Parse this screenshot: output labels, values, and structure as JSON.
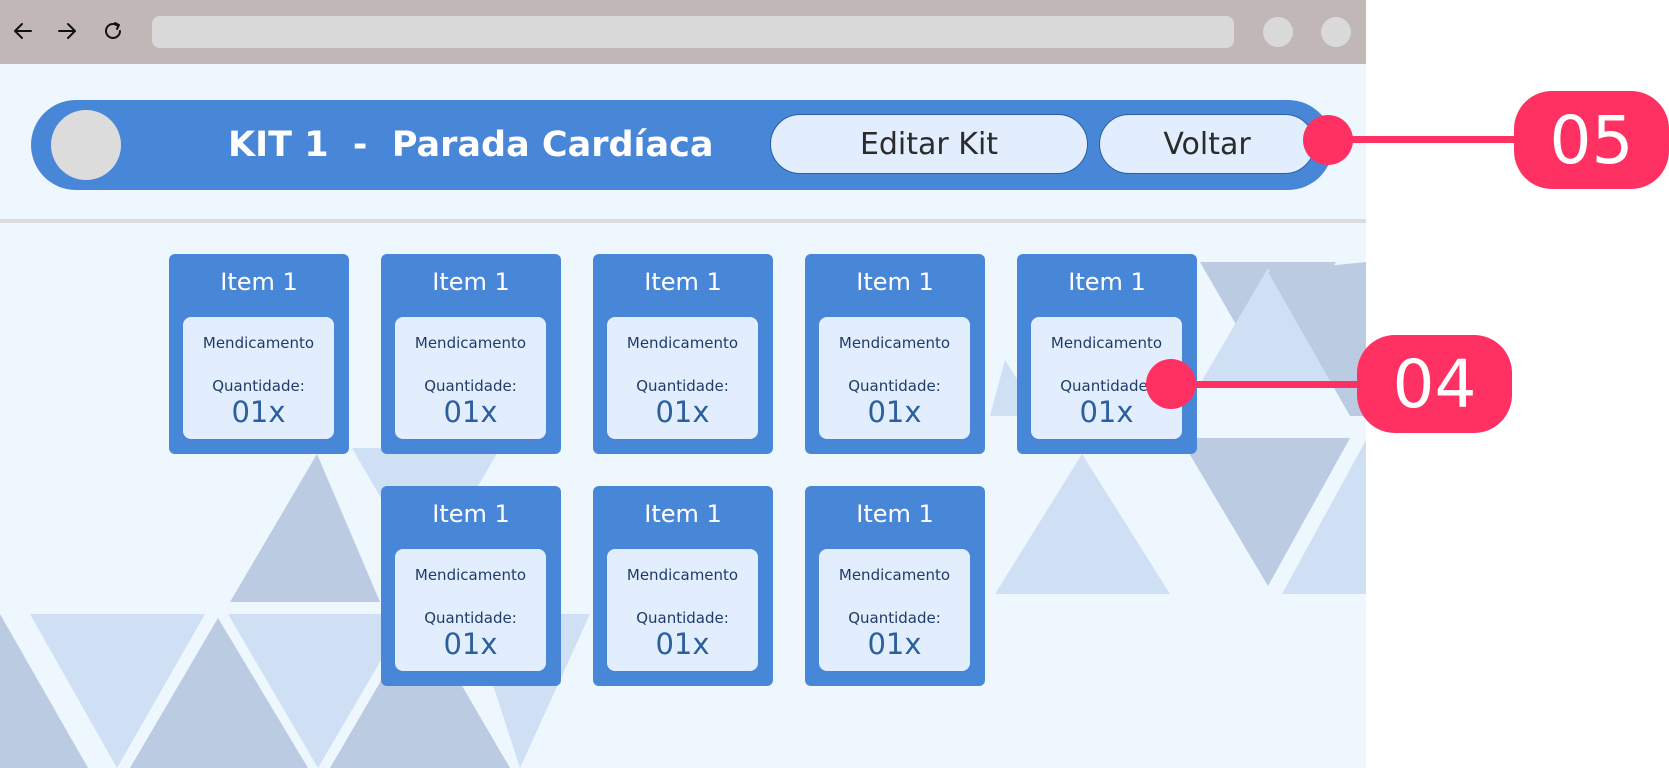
{
  "browser": {
    "icons": [
      "arrow-left-icon",
      "arrow-right-icon",
      "refresh-icon"
    ]
  },
  "header": {
    "title": "KIT 1  -  Parada Cardíaca",
    "edit_label": "Editar Kit",
    "back_label": "Voltar"
  },
  "items": [
    {
      "title": "Item 1",
      "med": "Mendicamento",
      "qty_label": "Quantidade:",
      "qty": "01x"
    },
    {
      "title": "Item 1",
      "med": "Mendicamento",
      "qty_label": "Quantidade:",
      "qty": "01x"
    },
    {
      "title": "Item 1",
      "med": "Mendicamento",
      "qty_label": "Quantidade:",
      "qty": "01x"
    },
    {
      "title": "Item 1",
      "med": "Mendicamento",
      "qty_label": "Quantidade:",
      "qty": "01x"
    },
    {
      "title": "Item 1",
      "med": "Mendicamento",
      "qty_label": "Quantidade:",
      "qty": "01x"
    },
    {
      "title": "Item 1",
      "med": "Mendicamento",
      "qty_label": "Quantidade:",
      "qty": "01x"
    },
    {
      "title": "Item 1",
      "med": "Mendicamento",
      "qty_label": "Quantidade:",
      "qty": "01x"
    },
    {
      "title": "Item 1",
      "med": "Mendicamento",
      "qty_label": "Quantidade:",
      "qty": "01x"
    }
  ],
  "annotations": {
    "badge_05": "05",
    "badge_04": "04"
  },
  "colors": {
    "primary": "#4886d8",
    "page_bg": "#eef6fe",
    "card_inner": "#e2eefd",
    "annotation": "#ff3163"
  }
}
